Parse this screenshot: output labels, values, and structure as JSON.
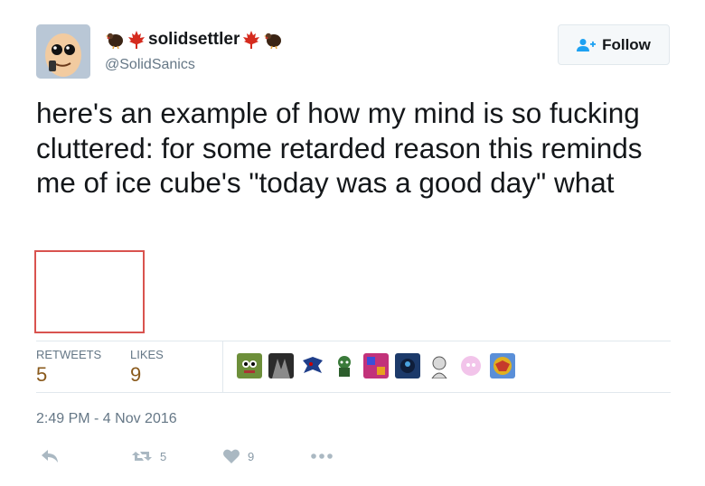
{
  "user": {
    "display_name": "solidsettler",
    "handle": "@SolidSanics",
    "emoji_left": [
      "turkey-icon",
      "maple-leaf-icon"
    ],
    "emoji_right": [
      "maple-leaf-icon",
      "turkey-icon"
    ]
  },
  "follow_button": {
    "label": "Follow",
    "icon": "add-user-icon"
  },
  "tweet": {
    "text": "here's an example of how my mind is so fucking cluttered: for some retarded reason this reminds me of ice cube's \"today was a good day\" what"
  },
  "stats": {
    "retweets_label": "RETWEETS",
    "retweets_value": "5",
    "likes_label": "LIKES",
    "likes_value": "9"
  },
  "likers": [
    {
      "name": "liker-avatar-1",
      "color": "#6d8f3a"
    },
    {
      "name": "liker-avatar-2",
      "color": "#2b2b2b"
    },
    {
      "name": "liker-avatar-3",
      "color": "#1f3e8a"
    },
    {
      "name": "liker-avatar-4",
      "color": "#3a7a3a"
    },
    {
      "name": "liker-avatar-5",
      "color": "#c2327a"
    },
    {
      "name": "liker-avatar-6",
      "color": "#1c3a6a"
    },
    {
      "name": "liker-avatar-7",
      "color": "#d8d8d8"
    },
    {
      "name": "liker-avatar-8",
      "color": "#f2c4ea"
    },
    {
      "name": "liker-avatar-9",
      "color": "#c63b2b"
    }
  ],
  "timestamp": "2:49 PM - 4 Nov 2016",
  "actions": {
    "reply_icon": "reply-icon",
    "retweet_icon": "retweet-icon",
    "retweet_count": "5",
    "like_icon": "heart-icon",
    "like_count": "9",
    "more_icon": "more-icon"
  },
  "colors": {
    "text": "#14171a",
    "secondary": "#657786",
    "stat_value": "#8a5a1c",
    "follow_icon": "#1da1f2",
    "action_icon": "#aab8c2",
    "placeholder_border": "#d9534f"
  }
}
